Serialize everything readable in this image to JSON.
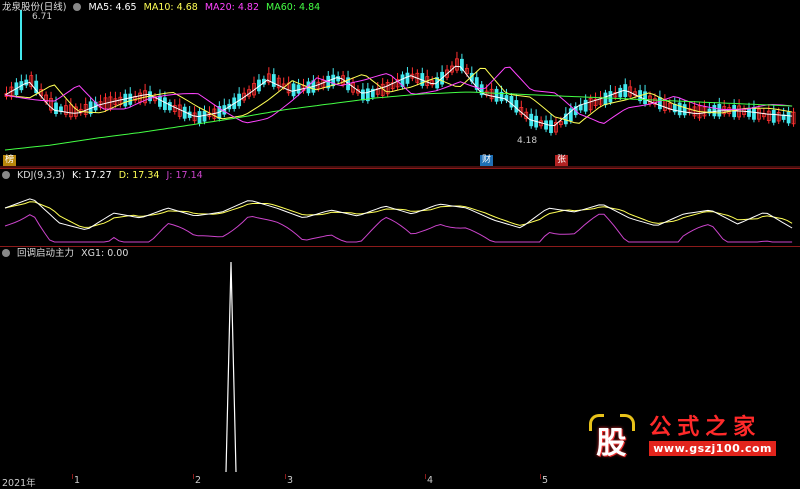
{
  "main": {
    "title": "龙泉股份(日线)",
    "ma": [
      {
        "label": "MA5: 4.65",
        "color": "#ffffff"
      },
      {
        "label": "MA10: 4.68",
        "color": "#ffff55"
      },
      {
        "label": "MA20: 4.82",
        "color": "#ff44ff"
      },
      {
        "label": "MA60: 4.84",
        "color": "#44ff44"
      }
    ],
    "high_label": "6.71",
    "low_label": "4.18",
    "tags": [
      "榜",
      "财",
      "张"
    ],
    "colors": {
      "up": "#ff3030",
      "down": "#44e8ee",
      "grid": "#8b1a1a"
    }
  },
  "kdj": {
    "title": "KDJ(9,3,3)",
    "k": "K: 17.27",
    "d": "D: 17.34",
    "j": "J: 17.14",
    "colors": {
      "k": "#ffffff",
      "d": "#ffff55",
      "j": "#cc44cc"
    }
  },
  "indicator": {
    "title": "回调启动主力",
    "xg1": "XG1: 0.00",
    "color": "#ffffff"
  },
  "axis": {
    "labels": [
      "2021年",
      "1",
      "2",
      "3",
      "4",
      "5"
    ]
  },
  "watermark": {
    "logo_char": "股",
    "title": "公式之家",
    "url": "www.gszj100.com"
  }
}
